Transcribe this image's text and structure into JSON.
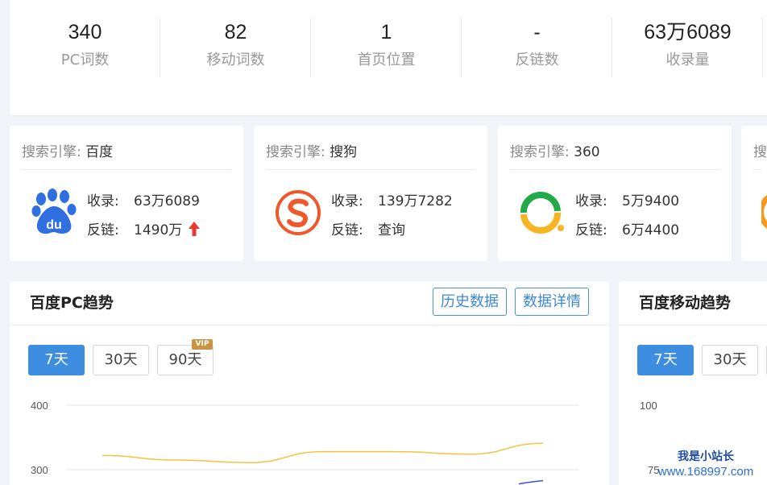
{
  "stats": [
    {
      "value": "340",
      "label": "PC词数"
    },
    {
      "value": "82",
      "label": "移动词数"
    },
    {
      "value": "1",
      "label": "首页位置"
    },
    {
      "value": "-",
      "label": "反链数"
    },
    {
      "value": "63万6089",
      "label": "收录量"
    }
  ],
  "engines": [
    {
      "prefix": "搜索引擎:",
      "name": "百度",
      "logo": "baidu-paw-icon",
      "index_label": "收录:",
      "index_value": "63万6089",
      "links_label": "反链:",
      "links_value": "1490万",
      "links_trend": "up-arrow-icon"
    },
    {
      "prefix": "搜索引擎:",
      "name": "搜狗",
      "logo": "sogou-icon",
      "index_label": "收录:",
      "index_value": "139万7282",
      "links_label": "反链:",
      "links_value": "查询"
    },
    {
      "prefix": "搜索引擎:",
      "name": "360",
      "logo": "so360-icon",
      "index_label": "收录:",
      "index_value": "5万9400",
      "links_label": "反链:",
      "links_value": "6万4400"
    },
    {
      "prefix": "搜"
    }
  ],
  "pc_trend": {
    "title": "百度PC趋势",
    "history_btn": "历史数据",
    "detail_btn": "数据详情",
    "ranges": [
      "7天",
      "30天",
      "90天"
    ],
    "active_range": "7天",
    "vip_badge": "VIP",
    "y_ticks": [
      "400",
      "300"
    ]
  },
  "mobile_trend": {
    "title": "百度移动趋势",
    "ranges": [
      "7天",
      "30天"
    ],
    "active_range": "7天",
    "y_ticks": [
      "100",
      "75"
    ]
  },
  "chart_data": {
    "type": "line",
    "ylim_visible": [
      300,
      400
    ],
    "series": [
      {
        "color": "#f5c342",
        "values": [
          322,
          315,
          311,
          328,
          328,
          324,
          341
        ]
      },
      {
        "color": "#3b4fd8",
        "values": [
          null,
          null,
          null,
          null,
          null,
          null,
          283
        ]
      }
    ]
  },
  "watermark": {
    "line1": "我是小站长",
    "line2": "www.168997.com"
  },
  "colors": {
    "accent": "#3d8ee0",
    "arrow_up": "#e8392f",
    "vip": "#c89444"
  }
}
